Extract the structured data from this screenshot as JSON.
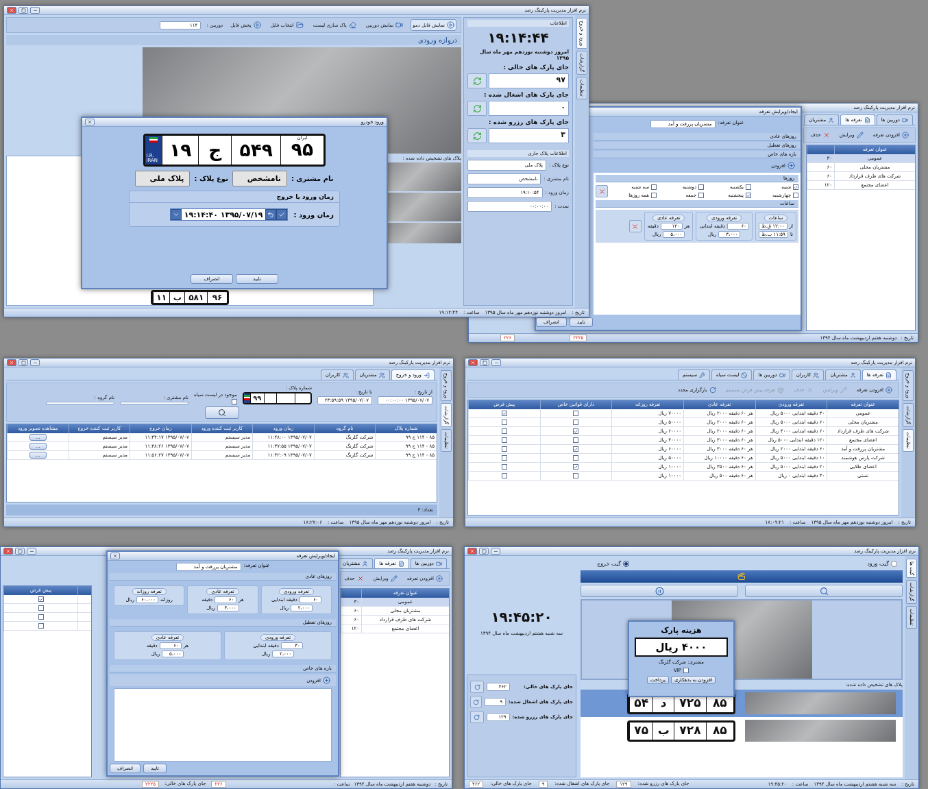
{
  "w1": {
    "title": "نرم افزار مدیریت پارکینگ رصد",
    "side_tabs": [
      {
        "label": "ورود و خروج",
        "selected": true
      },
      {
        "label": "گزارشات",
        "selected": false
      },
      {
        "label": "تنظیمات",
        "selected": false
      }
    ],
    "toolbar": [
      {
        "label": "نمایش فایل دمو",
        "kind": "play",
        "selected": true
      },
      {
        "label": "نمایش دوربین",
        "kind": "camera",
        "selected": false
      },
      {
        "label": "پاک سازی لیست",
        "kind": "eraser",
        "selected": false
      },
      {
        "label": "انتخاب فایل",
        "kind": "folder",
        "selected": false
      },
      {
        "label": "پخش فایل",
        "kind": "play",
        "selected": false
      }
    ],
    "camera_label": "دوربین :",
    "camera": "۱۱۴",
    "gate": "دروازه ورودی",
    "recognized_label": "پلاک های تشخیص داده شده :",
    "bottom_plate": {
      "p1": "۱۱",
      "letter": "ب",
      "p3": "۵۸۱",
      "region": "۹۶"
    },
    "info": {
      "header": "اطلاعات",
      "clock": "۱۹:۱۴:۴۴",
      "date": "امروز دوشنبه نوزدهم مهر ماه  سال ۱۳۹۵",
      "counters": [
        {
          "label": "جای پارک های خالی :",
          "value": "۹۷"
        },
        {
          "label": "جای پارک های اشغال شده :",
          "value": "۰"
        },
        {
          "label": "جای پارک های رزرو شده :",
          "value": "۳"
        }
      ],
      "plate_header": "اطلاعات پلاک جاری",
      "fields": [
        {
          "label": "نوع پلاک :",
          "value": "پلاک ملی"
        },
        {
          "label": "نام مشتری :",
          "value": "نامشخص"
        },
        {
          "label": "زمان ورود :",
          "value": "۱۹:۱۰:۵۴"
        },
        {
          "label": "بمدت :",
          "value": "۰۰:۰۰:۰۰"
        }
      ]
    },
    "status": {
      "date_label": "تاریخ :",
      "date": "امروز دوشنبه نوزدهم مهر ماه  سال ۱۳۹۵",
      "time_label": "ساعت :",
      "time": "۱۹:۱۲:۴۴"
    },
    "dialog": {
      "title": "ورود خودرو",
      "plate": {
        "country": "I.R. IRAN",
        "p1": "۱۹",
        "letter": "ج",
        "p3": "۵۴۹",
        "region_label": "ایران",
        "region": "۹۵"
      },
      "customer_label": "نام مشتری :",
      "customer": "نامشخص",
      "type_label": "نوع پلاک :",
      "plate_type": "پلاک ملی",
      "section": "زمان ورود یا خروج",
      "entry_label": "زمان ورود :",
      "entry": "۱۳۹۵/۰۷/۱۹ ۱۹:۱۴:۴۰",
      "buttons": [
        "تایید",
        "انصراف"
      ]
    }
  },
  "w2": {
    "title": "نرم افزار مدیریت پارکینگ رصد",
    "tabs": [
      {
        "label": "دوربین ها",
        "selected": false
      },
      {
        "label": "تعرفه ها",
        "selected": true
      },
      {
        "label": "مشتریان",
        "selected": false
      }
    ],
    "toolbar": [
      "افزودن تعرفه",
      "ویرایش",
      "حذف"
    ],
    "column": "عنوان تعرفه",
    "rows": [
      {
        "name": "عمومی",
        "minutes": "۳۰",
        "selected": true
      },
      {
        "name": "مشتریان محلی",
        "minutes": "۶۰",
        "selected": false
      },
      {
        "name": "شرکت های طرف قرارداد",
        "minutes": "۶۰",
        "selected": false
      },
      {
        "name": "اعضای مجتمع",
        "minutes": "۱۲۰",
        "selected": false
      }
    ],
    "status": {
      "date_label": "تاریخ :",
      "date": "دوشنبه هفتم اردیبهشت ماه  سال ۱۳۹۴",
      "counters": [
        "۲۲۲۵",
        "۲۲۶"
      ]
    },
    "dialog": {
      "title": "ایجاد/ویرایش تعرفه",
      "name_label": "عنوان تعرفه:",
      "name": "مشتریان پررفت و آمد",
      "sections": [
        "روزهای عادی",
        "روزهای تعطیل",
        "بازه های خاص"
      ],
      "add": "افزودن",
      "days_header": "روزها",
      "days": [
        {
          "label": "شنبه",
          "checked": true
        },
        {
          "label": "یکشنبه",
          "checked": false
        },
        {
          "label": "دوشنبه",
          "checked": false
        },
        {
          "label": "سه شنبه",
          "checked": false
        },
        {
          "label": "چهارشنبه",
          "checked": false
        },
        {
          "label": "پنجشنبه",
          "checked": true
        },
        {
          "label": "جمعه",
          "checked": false
        },
        {
          "label": "همه روزها",
          "checked": false
        }
      ],
      "hours_header": "ساعات",
      "groups": [
        {
          "title": "ساعات",
          "rows": [
            {
              "prefix": "از",
              "value": "۱۲:۰۰ ق.ظ"
            },
            {
              "prefix": "تا",
              "value": "۱۱:۵۹ ب.ظ"
            }
          ]
        },
        {
          "title": "تعرفه ورودی",
          "rows": [
            {
              "value": "۶۰",
              "suffix": "دقیقه ابتدایی"
            },
            {
              "value": "۳،۰۰۰",
              "suffix": "ریال"
            }
          ]
        },
        {
          "title": "تعرفه عادی",
          "rows": [
            {
              "prefix": "هر",
              "value": "۱۲۰",
              "suffix": "دقیقه"
            },
            {
              "value": "۵،۰۰۰",
              "suffix": "ریال"
            }
          ]
        }
      ],
      "buttons": [
        "تایید",
        "انصراف"
      ]
    }
  },
  "w3": {
    "title": "نرم افزار مدیریت پارکینگ رصد",
    "side_tabs": [
      {
        "label": "ورود و خروج",
        "selected": false
      },
      {
        "label": "گزارشات",
        "selected": true
      },
      {
        "label": "تنظیمات",
        "selected": false
      }
    ],
    "tabs": [
      {
        "label": "ورود و خروج",
        "selected": true
      },
      {
        "label": "مشتریان",
        "selected": false
      },
      {
        "label": "کاربران",
        "selected": false
      }
    ],
    "from_label": "از تاریخ :",
    "from": "۱۳۹۵/۰۷/۰۷ ۰۰:۰۰:۰۰",
    "to_label": "تا تاریخ :",
    "to": "۱۳۹۵/۰۷/۰۷ ۲۳:۵۹:۵۹",
    "plate_label": "شماره پلاک :",
    "plate": "۹۹",
    "blacklist_label": "موجود در لیست سیاه",
    "blacklist": false,
    "customer_label": "نام مشتری :",
    "group_label": "نام گروه :",
    "columns": [
      "شماره پلاک",
      "نام گروه",
      "زمان ورود",
      "کاربر ثبت کننده ورود",
      "زمان خروج",
      "کاربر ثبت کننده خروج",
      "مشاهده تصویر ورود"
    ],
    "rows": [
      [
        "۸۵ - ۱۱۴ ج ۹۹",
        "شرکت گلرنگ",
        "۱۳۹۵/۰۷/۰۷ ۱۱:۴۸:۰۰",
        "مدیر سیستم",
        "۱۳۹۵/۰۷/۰۷ ۱۱:۴۴:۱۷",
        "مدیر سیستم",
        "..."
      ],
      [
        "۸۵ - ۱۱۴ ج ۹۹",
        "شرکت گلرنگ",
        "۱۳۹۵/۰۷/۰۷ ۱۱:۳۷:۵۵",
        "مدیر سیستم",
        "۱۳۹۵/۰۷/۰۷ ۱۱:۳۸:۲۶",
        "مدیر سیستم",
        "..."
      ],
      [
        "۸۵ - ۱۱۴ ج ۹۹",
        "شرکت گلرنگ",
        "۱۳۹۵/۰۷/۰۷ ۱۱:۴۲:۰۹",
        "مدیر سیستم",
        "۱۳۹۵/۰۷/۰۷ ۱۱:۵۶:۲۷",
        "مدیر سیستم",
        "..."
      ]
    ],
    "count": "تعداد: ۳",
    "status": {
      "date_label": "تاریخ :",
      "date": "امروز دوشنبه نوزدهم مهر ماه  سال ۱۳۹۵",
      "time_label": "ساعت :",
      "time": "۱۸:۲۷:۰۶"
    }
  },
  "w4": {
    "title": "نرم افزار مدیریت پارکینگ رصد",
    "side_tabs": [
      {
        "label": "ورود و خروج",
        "selected": false
      },
      {
        "label": "گزارشات",
        "selected": false
      },
      {
        "label": "تنظیمات",
        "selected": true
      }
    ],
    "tabs": [
      {
        "label": "تعرفه ها",
        "selected": true
      },
      {
        "label": "مشتریان",
        "selected": false
      },
      {
        "label": "کاربران",
        "selected": false
      },
      {
        "label": "دوربین ها",
        "selected": false
      },
      {
        "label": "لیست سیاه",
        "selected": false
      },
      {
        "label": "سیستم",
        "selected": false
      }
    ],
    "toolbar": [
      {
        "label": "افزودن تعرفه",
        "disabled": false
      },
      {
        "label": "ویرایش",
        "disabled": true
      },
      {
        "label": "حذف",
        "disabled": true
      },
      {
        "label": "تعرفه پیش فرض سیستم",
        "disabled": true
      },
      {
        "label": "بارگزاری مجدد",
        "disabled": false
      }
    ],
    "columns": [
      "عنوان تعرفه",
      "تعرفه ورودی",
      "تعرفه عادی",
      "تعرفه روزانه",
      "دارای قوانین خاص",
      "پیش فرض"
    ],
    "rows": [
      {
        "name": "عمومی",
        "entry": "۳۰ دقیقه ابتدایی ۵۰۰۰ ریال",
        "normal": "هر ۶۰ دقیقه ۲۰۰۰ ریال",
        "daily": "۷۰۰۰۰ ریال",
        "special": false,
        "default": true
      },
      {
        "name": "مشتریان محلی",
        "entry": "۶۰ دقیقه ابتدایی ۵۰۰۰ ریال",
        "normal": "هر ۶۰ دقیقه ۲۰۰۰ ریال",
        "daily": "۵۰۰۰۰ ریال",
        "special": false,
        "default": false
      },
      {
        "name": "شرکت های طرف قرارداد",
        "entry": "۶۰ دقیقه ابتدایی ۴۰۰۰ ریال",
        "normal": "هر ۶۰ دقیقه ۲۰۰۰ ریال",
        "daily": "۶۰۰۰۰ ریال",
        "special": true,
        "default": false
      },
      {
        "name": "اعضای مجتمع",
        "entry": "۱۲۰ دقیقه ابتدایی ۵۰۰۰ ریال",
        "normal": "هر ۶۰ دقیقه ۳۰۰۰ ریال",
        "daily": "۴۰۰۰۰ ریال",
        "special": false,
        "default": false
      },
      {
        "name": "مشتریان پررفت و آمد",
        "entry": "۶۰ دقیقه ابتدایی ۲۰۰۰ ریال",
        "normal": "هر ۶۰ دقیقه ۳۰۰۰ ریال",
        "daily": "۶۰۰۰۰ ریال",
        "special": true,
        "default": false
      },
      {
        "name": "شرکت پارس هوشمند",
        "entry": "۱۰ دقیقه ابتدایی ۵۰۰۰ ریال",
        "normal": "هر ۶۰ دقیقه ۱۰۰۰۰ ریال",
        "daily": "۵۰۰۰۰ ریال",
        "special": false,
        "default": false
      },
      {
        "name": "اعضای طلایی",
        "entry": "۲۰ دقیقه ابتدایی ۵۰۰۰ ریال",
        "normal": "هر ۶۰ دقیقه ۳۵۰۰ ریال",
        "daily": "۱۰۰۰۰ ریال",
        "special": true,
        "default": false
      },
      {
        "name": "تستی",
        "entry": "۳۰ دقیقه ابتدایی ۰ ریال",
        "normal": "هر ۶۰ دقیقه ۵۰۰ ریال",
        "daily": "۱۰۰۰۰ ریال",
        "special": false,
        "default": false
      }
    ],
    "status": {
      "date_label": "تاریخ :",
      "date": "امروز دوشنبه نوزدهم مهر ماه  سال ۱۳۹۵",
      "time_label": "ساعت :",
      "time": "۱۸:۰۹:۲۱"
    }
  },
  "w5": {
    "title": "نرم افزار مدیریت پارکینگ رصد",
    "tabs": [
      {
        "label": "دوربین ها",
        "selected": false
      },
      {
        "label": "تعرفه ها",
        "selected": true
      },
      {
        "label": "مشتریان",
        "selected": false
      }
    ],
    "toolbar": [
      "افزودن تعرفه",
      "ویرایش",
      "حذف"
    ],
    "columns": [
      "عنوان تعرفه",
      "پیش فرض"
    ],
    "rows": [
      {
        "name": "عمومی",
        "minutes": "۳۰",
        "default": true,
        "selected": true
      },
      {
        "name": "مشتریان محلی",
        "minutes": "۶۰",
        "default": false,
        "selected": false
      },
      {
        "name": "شرکت های طرف قرارداد",
        "minutes": "۶۰",
        "default": false,
        "selected": false
      },
      {
        "name": "اعضای مجتمع",
        "minutes": "۱۲۰",
        "default": false,
        "selected": false
      }
    ],
    "status": {
      "date_label": "تاریخ :",
      "date": "دوشنبه هفتم اردیبهشت ماه  سال ۱۳۹۴",
      "time_label": "ساعت :",
      "counter_label": "جای پارک های خالی:",
      "counters": [
        "۲۲۶",
        "۲۲۲۵"
      ]
    },
    "dialog": {
      "title": "ایجاد/ویرایش تعرفه",
      "name_label": "عنوان تعرفه:",
      "name": "مشتریان پررفت و آمد",
      "sections": [
        {
          "title": "روزهای عادی",
          "groups": [
            {
              "title": "تعرفه ورودی",
              "rows": [
                {
                  "value": "۶۰",
                  "suffix": "دقیقه ابتدایی"
                },
                {
                  "value": "۲،۰۰۰",
                  "suffix": "ریال"
                }
              ]
            },
            {
              "title": "تعرفه عادی",
              "rows": [
                {
                  "prefix": "هر",
                  "value": "۶۰",
                  "suffix": "دقیقه"
                },
                {
                  "value": "۳،۰۰۰",
                  "suffix": "ریال"
                }
              ]
            },
            {
              "title": "تعرفه روزانه",
              "rows": [
                {
                  "prefix": "روزانه",
                  "value": "۶۰،۰۰۰",
                  "suffix": "ریال"
                }
              ]
            }
          ]
        },
        {
          "title": "روزهای تعطیل",
          "groups": [
            {
              "title": "تعرفه ورودی",
              "rows": [
                {
                  "value": "۳۰",
                  "suffix": "دقیقه ابتدایی"
                },
                {
                  "value": "۲،۰۰۰",
                  "suffix": "ریال"
                }
              ]
            },
            {
              "title": "تعرفه عادی",
              "rows": [
                {
                  "prefix": "هر",
                  "value": "۶۰",
                  "suffix": "دقیقه"
                },
                {
                  "value": "۵،۰۰۰",
                  "suffix": "ریال"
                }
              ]
            }
          ]
        }
      ],
      "special": "بازه های خاص",
      "add": "افزودن",
      "buttons": [
        "تایید",
        "انصراف"
      ]
    }
  },
  "w6": {
    "title": "نرم افزار مدیریت پارکینگ رصد",
    "side_tabs": [
      {
        "label": "گیت ها",
        "selected": true
      },
      {
        "label": "گزارشات",
        "selected": false
      },
      {
        "label": "تنظیمات",
        "selected": false
      }
    ],
    "gates": [
      {
        "label": "گیت ورود",
        "selected": false
      },
      {
        "label": "گیت خروج",
        "selected": true
      }
    ],
    "clock": "۱۹:۴۵:۲۰",
    "date": "سه شنبه هشتم اردیبهشت ماه  سال ۱۳۹۴",
    "counters": [
      {
        "label": "جای پارک های خالی:",
        "value": "۴۶۲"
      },
      {
        "label": "جای پارک های اشغال شده:",
        "value": "۹"
      },
      {
        "label": "جای پارک های رزرو شده:",
        "value": "۱۲۹"
      }
    ],
    "recognized_label": "پلاک های تشخیص داده شده:",
    "plates": [
      {
        "p1": "۵۴",
        "letter": "د",
        "p3": "۷۲۵",
        "region": "۸۵",
        "selected": true
      },
      {
        "p1": "۷۵",
        "letter": "ب",
        "p3": "۷۲۸",
        "region": "۸۵",
        "selected": false
      }
    ],
    "fee": {
      "title": "هزینه پارک",
      "amount": "۴۰۰۰  ریال",
      "customer": "مشتری: شرکت گلرنگ",
      "vip_label": "VIP",
      "vip": false,
      "buttons": [
        "افزودن به بدهکاری",
        "پرداخت"
      ]
    },
    "status": {
      "date_label": "تاریخ :",
      "date": "سه شنبه هشتم اردیبهشت ماه  سال ۱۳۹۴",
      "time_label": "ساعت :",
      "time": "۱۹:۴۵:۲۰",
      "counters": [
        {
          "label": "جای پارک های رزرو شده:",
          "value": "۱۲۹"
        },
        {
          "label": "جای پارک های اشغال شده:",
          "value": "۹"
        },
        {
          "label": "جای پارک های خالی:",
          "value": "۴۶۲"
        }
      ]
    }
  }
}
